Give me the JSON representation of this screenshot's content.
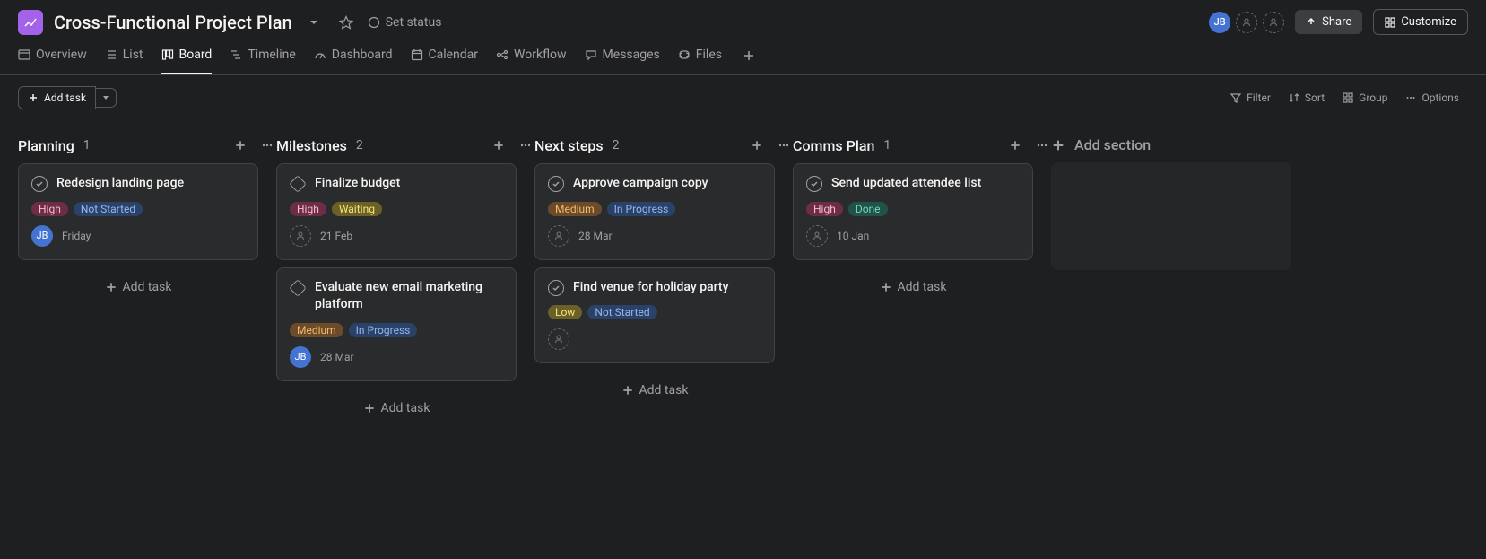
{
  "header": {
    "project_title": "Cross-Functional Project Plan",
    "set_status_label": "Set status",
    "user_initials": "JB",
    "share_label": "Share",
    "customize_label": "Customize"
  },
  "tabs": {
    "items": [
      {
        "label": "Overview"
      },
      {
        "label": "List"
      },
      {
        "label": "Board"
      },
      {
        "label": "Timeline"
      },
      {
        "label": "Dashboard"
      },
      {
        "label": "Calendar"
      },
      {
        "label": "Workflow"
      },
      {
        "label": "Messages"
      },
      {
        "label": "Files"
      }
    ],
    "active_index": 2
  },
  "toolbar": {
    "add_task_label": "Add task",
    "filter_label": "Filter",
    "sort_label": "Sort",
    "group_label": "Group",
    "options_label": "Options"
  },
  "board": {
    "add_task_label": "Add task",
    "add_section_label": "Add section",
    "columns": [
      {
        "title": "Planning",
        "count": "1",
        "cards": [
          {
            "type": "task",
            "title": "Redesign landing page",
            "tags": [
              {
                "text": "High",
                "class": "tag-high"
              },
              {
                "text": "Not Started",
                "class": "tag-notstarted"
              }
            ],
            "assignee": {
              "type": "jb",
              "initials": "JB"
            },
            "date": "Friday"
          }
        ]
      },
      {
        "title": "Milestones",
        "count": "2",
        "cards": [
          {
            "type": "milestone",
            "title": "Finalize budget",
            "tags": [
              {
                "text": "High",
                "class": "tag-high"
              },
              {
                "text": "Waiting",
                "class": "tag-waiting"
              }
            ],
            "assignee": {
              "type": "dashed"
            },
            "date": "21 Feb"
          },
          {
            "type": "milestone",
            "title": "Evaluate new email marketing platform",
            "tags": [
              {
                "text": "Medium",
                "class": "tag-medium"
              },
              {
                "text": "In Progress",
                "class": "tag-inprogress"
              }
            ],
            "assignee": {
              "type": "jb",
              "initials": "JB"
            },
            "date": "28 Mar"
          }
        ]
      },
      {
        "title": "Next steps",
        "count": "2",
        "cards": [
          {
            "type": "task",
            "title": "Approve campaign copy",
            "tags": [
              {
                "text": "Medium",
                "class": "tag-medium"
              },
              {
                "text": "In Progress",
                "class": "tag-inprogress"
              }
            ],
            "assignee": {
              "type": "dashed"
            },
            "date": "28 Mar"
          },
          {
            "type": "task",
            "title": "Find venue for holiday party",
            "tags": [
              {
                "text": "Low",
                "class": "tag-low"
              },
              {
                "text": "Not Started",
                "class": "tag-notstarted"
              }
            ],
            "assignee": {
              "type": "dashed"
            },
            "date": ""
          }
        ]
      },
      {
        "title": "Comms Plan",
        "count": "1",
        "cards": [
          {
            "type": "task",
            "title": "Send updated attendee list",
            "tags": [
              {
                "text": "High",
                "class": "tag-high"
              },
              {
                "text": "Done",
                "class": "tag-done"
              }
            ],
            "assignee": {
              "type": "dashed"
            },
            "date": "10 Jan"
          }
        ]
      }
    ]
  }
}
